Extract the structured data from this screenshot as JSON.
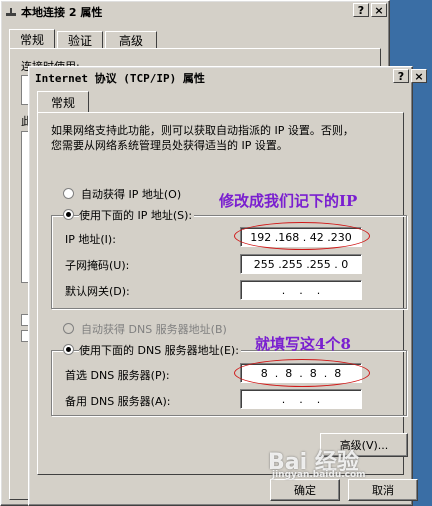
{
  "back_window": {
    "title": "本地连接 2 属性",
    "tabs": [
      "常规",
      "验证",
      "高级"
    ],
    "partial_text": "连接时使用:",
    "partial_label": "此"
  },
  "dialog": {
    "title": "Internet 协议 (TCP/IP) 属性",
    "tab": "常规",
    "description": "如果网络支持此功能，则可以获取自动指派的 IP 设置。否则，\n您需要从网络系统管理员处获得适当的 IP 设置。",
    "radio_auto_ip": "自动获得 IP 地址(O)",
    "radio_manual_ip": "使用下面的 IP 地址(S):",
    "ip_label": "IP 地址(I):",
    "ip_value": "192 .168 . 42 .230",
    "mask_label": "子网掩码(U):",
    "mask_value": "255 .255 .255 . 0",
    "gateway_label": "默认网关(D):",
    "gateway_value": " .    .    . ",
    "radio_auto_dns": "自动获得 DNS 服务器地址(B)",
    "radio_manual_dns": "使用下面的 DNS 服务器地址(E):",
    "dns1_label": "首选 DNS 服务器(P):",
    "dns1_value": "8  .  8  .  8  .  8",
    "dns2_label": "备用 DNS 服务器(A):",
    "dns2_value": " .    .    . ",
    "advanced_button": "高级(V)...",
    "ok_button": "确定",
    "cancel_button": "取消",
    "help_glyph": "?",
    "close_glyph": "×"
  },
  "annotations": {
    "ip_note": "修改成我们记下的IP",
    "dns_note": "就填写这4个8"
  },
  "watermark": {
    "main": "Bai 经验",
    "sub": "jingyan.baidu.com"
  },
  "colors": {
    "annotation": "#7a1fd0",
    "circle": "#d01818",
    "desktop": "#3a6ea5"
  }
}
